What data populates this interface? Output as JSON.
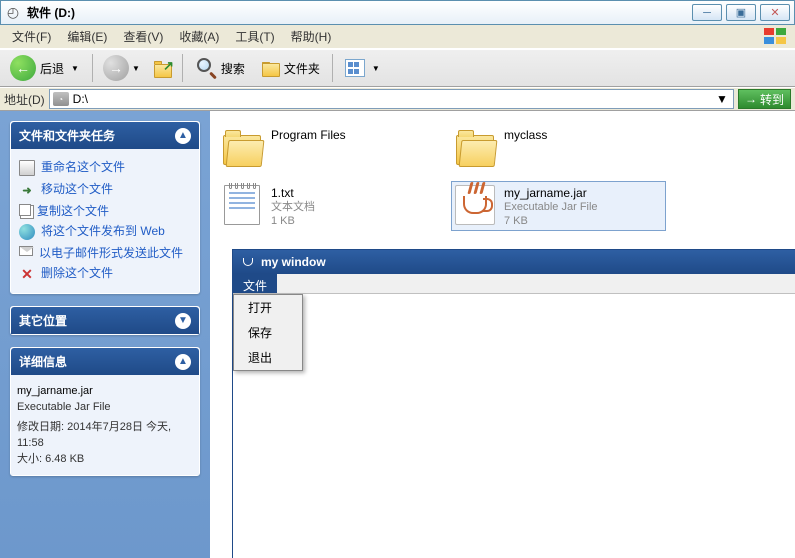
{
  "window": {
    "title": "软件 (D:)"
  },
  "menu": {
    "file": "文件(F)",
    "edit": "编辑(E)",
    "view": "查看(V)",
    "favorites": "收藏(A)",
    "tools": "工具(T)",
    "help": "帮助(H)"
  },
  "toolbar": {
    "back": "后退",
    "search": "搜索",
    "folders": "文件夹"
  },
  "address": {
    "label": "地址(D)",
    "value": "D:\\",
    "go": "转到"
  },
  "sidebar": {
    "tasks_title": "文件和文件夹任务",
    "tasks": [
      {
        "label": "重命名这个文件",
        "iconcls": "doc"
      },
      {
        "label": "移动这个文件",
        "iconcls": "move"
      },
      {
        "label": "复制这个文件",
        "iconcls": "copy"
      },
      {
        "label": "将这个文件发布到 Web",
        "iconcls": "web"
      },
      {
        "label": "以电子邮件形式发送此文件",
        "iconcls": "mail"
      },
      {
        "label": "删除这个文件",
        "iconcls": "delete"
      }
    ],
    "places_title": "其它位置",
    "details_title": "详细信息",
    "details": {
      "name": "my_jarname.jar",
      "type": "Executable Jar File",
      "modified_label": "修改日期: ",
      "modified_value": "2014年7月28日 今天, 11:58",
      "size_label": "大小: ",
      "size_value": "6.48 KB"
    }
  },
  "files": {
    "program_files": {
      "name": "Program Files"
    },
    "myclass": {
      "name": "myclass"
    },
    "txt": {
      "name": "1.txt",
      "type": "文本文档",
      "size": "1 KB"
    },
    "jar": {
      "name": "my_jarname.jar",
      "type": "Executable Jar File",
      "size": "7 KB"
    }
  },
  "javawin": {
    "title": "my window",
    "menu_file": "文件",
    "items": {
      "open": "打开",
      "save": "保存",
      "exit": "退出"
    }
  }
}
